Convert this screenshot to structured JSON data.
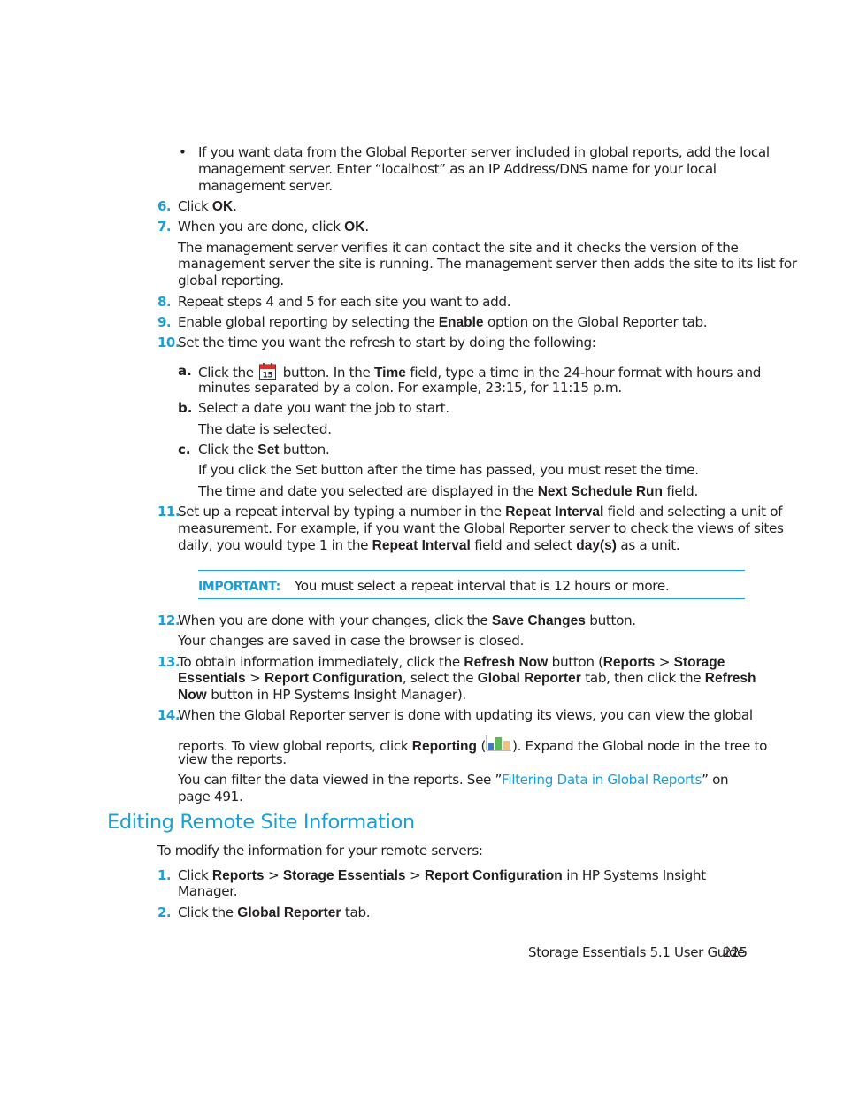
{
  "document": {
    "bullet_intro": {
      "lines": [
        "If you want data from the Global Reporter server included in global reports, add the local",
        "management server. Enter “localhost” as an IP Address/DNS name for your local",
        "management server."
      ]
    },
    "steps": {
      "s6": {
        "num": "6.",
        "pre": "Click ",
        "bold": "OK",
        "post": "."
      },
      "s7": {
        "num": "7.",
        "pre": "When you are done, click ",
        "bold": "OK",
        "post": "."
      },
      "s7_note": [
        "The management server verifies it can contact the site and it checks the version of the",
        "management server the site is running. The management server then adds the site to its list for",
        "global reporting."
      ],
      "s8": {
        "num": "8.",
        "text": "Repeat steps 4 and 5 for each site you want to add."
      },
      "s9": {
        "num": "9.",
        "pre": "Enable global reporting by selecting the ",
        "bold": "Enable",
        "post": " option on the Global Reporter tab."
      },
      "s10": {
        "num": "10.",
        "text": "Set the time you want the refresh to start by doing the following:"
      },
      "s10a": {
        "label": "a.",
        "pre": "Click the ",
        "icon": "calendar-icon",
        "icon_text": "15",
        "mid": " button. In the ",
        "bold": "Time",
        "post": " field, type a time in the 24-hour format with hours and",
        "line2": "minutes separated by a colon. For example, 23:15, for 11:15 p.m."
      },
      "s10b": {
        "label": "b.",
        "text": "Select a date you want the job to start.",
        "note": "The date is selected."
      },
      "s10c": {
        "label": "c.",
        "pre": "Click the ",
        "bold": "Set",
        "post": " button.",
        "note1": "If you click the Set button after the time has passed, you must reset the time.",
        "note2_pre": "The time and date you selected are displayed in the ",
        "note2_bold": "Next Schedule Run",
        "note2_post": " field."
      },
      "s11": {
        "num": "11.",
        "l1_pre": "Set up a repeat interval by typing a number in the ",
        "l1_bold": "Repeat Interval",
        "l1_post": " field and selecting a unit of",
        "l2": "measurement. For example, if you want the Global Reporter server to check the views of sites",
        "l3_pre": "daily, you would type 1 in the ",
        "l3_bold1": "Repeat Interval",
        "l3_mid": " field and select ",
        "l3_bold2": "day(s)",
        "l3_post": " as a unit."
      },
      "important": {
        "label": "IMPORTANT:",
        "text": "You must select a repeat interval that is 12 hours or more."
      },
      "s12": {
        "num": "12.",
        "pre": "When you are done with your changes, click the ",
        "bold": "Save Changes",
        "post": " button.",
        "note": "Your changes are saved in case the browser is closed."
      },
      "s13": {
        "num": "13.",
        "l1_pre": "To obtain information immediately, click the ",
        "l1_b1": "Refresh Now",
        "l1_mid": " button (",
        "l1_b2": "Reports",
        "l1_gt": " > ",
        "l1_b3": "Storage",
        "l2_b1": "Essentials",
        "l2_gt": " > ",
        "l2_b2": "Report Configuration",
        "l2_mid": ", select the ",
        "l2_b3": "Global Reporter",
        "l2_mid2": " tab, then click the ",
        "l2_b4": "Refresh",
        "l3_b1": "Now",
        "l3_post": " button in HP Systems Insight Manager)."
      },
      "s14": {
        "num": "14.",
        "l1": "When the Global Reporter server is done with updating its views, you can view the global",
        "l2_pre": "reports. To view global reports, click ",
        "l2_bold": "Reporting",
        "l2_open": " (",
        "icon": "reporting-icon",
        "l2_post": "). Expand the Global node in the tree to",
        "l3": "view the reports.",
        "l4_pre": "You can filter the data viewed in the reports. See ”",
        "l4_link": "Filtering Data in Global Reports",
        "l4_post": "” on",
        "l5": "page 491."
      }
    },
    "section": {
      "heading": "Editing Remote Site Information",
      "intro": "To modify the information for your remote servers:",
      "s1": {
        "num": "1.",
        "pre": "Click ",
        "b1": "Reports",
        "gt1": " > ",
        "b2": "Storage Essentials",
        "gt2": " > ",
        "b3": "Report Configuration",
        "post": " in HP Systems Insight",
        "l2": "Manager."
      },
      "s2": {
        "num": "2.",
        "pre": "Click the ",
        "bold": "Global Reporter",
        "post": " tab."
      }
    },
    "footer": {
      "guide": "Storage Essentials 5.1 User Guide",
      "page": "225"
    },
    "colors": {
      "accent": "#1a9fd9",
      "text": "#231f20"
    }
  }
}
